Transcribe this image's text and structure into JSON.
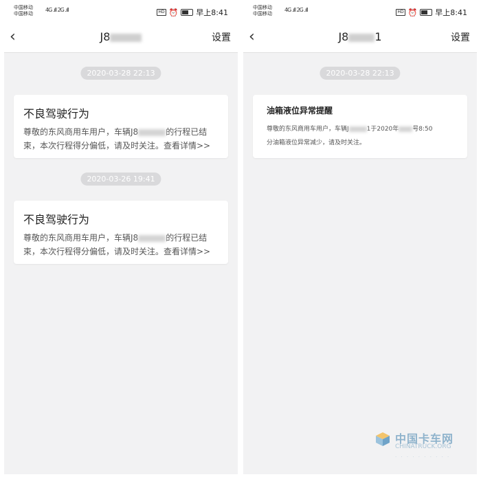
{
  "status_bar": {
    "carrier_1": "中国移动",
    "carrier_2": "中国移动",
    "signal_text": "4G .ıll 2G .ıll ",
    "hd": "HD",
    "time": "早上8:41"
  },
  "left": {
    "nav": {
      "title": "J8",
      "settings": "设置"
    },
    "messages": [
      {
        "time": "2020-03-28 22:13",
        "title": "不良驾驶行为",
        "line1": "尊敬的东风商用车用户，车辆J8",
        "line1_end": "的行程已结",
        "line2": "束，本次行程得分偏低，请及时关注。查看详情>>"
      },
      {
        "time": "2020-03-26 19:41",
        "title": "不良驾驶行为",
        "line1": "尊敬的东风商用车用户，车辆J8",
        "line1_end": "的行程已结",
        "line2": "束，本次行程得分偏低，请及时关注。查看详情>>"
      }
    ]
  },
  "right": {
    "nav": {
      "title": "J8",
      "title_end": "1",
      "settings": "设置"
    },
    "message": {
      "time": "2020-03-28 22:13",
      "title": "油箱液位异常提醒",
      "line1_a": "尊敬的东风商用车用户，车辆J",
      "line1_b": "1于2020年",
      "line1_c": "号8:50",
      "line2": "分油箱液位异常减少，请及时关注。"
    }
  },
  "watermark": {
    "cn": "中国卡车网",
    "en": "CHINATRUCK.ORG"
  },
  "colors": {
    "panel_bg": "#f2f2f3",
    "pill_bg": "#d9d9db",
    "card_bg": "#ffffff"
  }
}
